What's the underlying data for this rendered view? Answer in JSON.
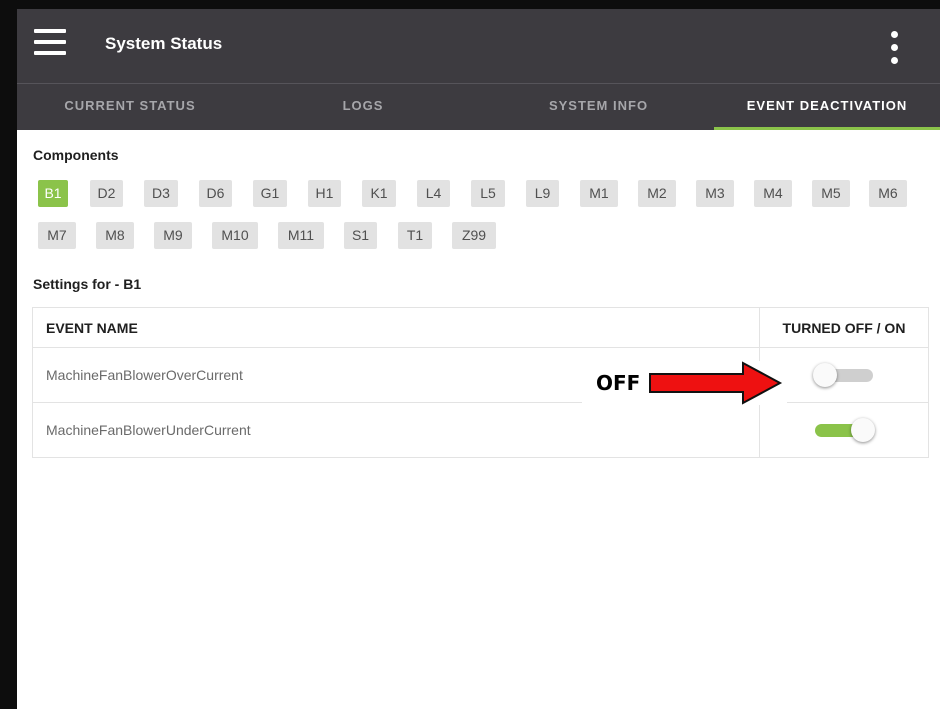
{
  "app": {
    "title": "System Status"
  },
  "tabs": [
    {
      "label": "CURRENT STATUS",
      "active": false
    },
    {
      "label": "LOGS",
      "active": false
    },
    {
      "label": "SYSTEM INFO",
      "active": false
    },
    {
      "label": "EVENT DEACTIVATION",
      "active": true
    }
  ],
  "components": {
    "heading": "Components",
    "selected": "B1",
    "chips": [
      "B1",
      "D2",
      "D3",
      "D6",
      "G1",
      "H1",
      "K1",
      "L4",
      "L5",
      "L9",
      "M1",
      "M2",
      "M3",
      "M4",
      "M5",
      "M6",
      "M7",
      "M8",
      "M9",
      "M10",
      "M11",
      "S1",
      "T1",
      "Z99"
    ]
  },
  "settings": {
    "heading": "Settings for - B1",
    "columns": {
      "event_name": "EVENT NAME",
      "toggle": "TURNED OFF / ON"
    },
    "rows": [
      {
        "event": "MachineFanBlowerOverCurrent",
        "enabled": false
      },
      {
        "event": "MachineFanBlowerUnderCurrent",
        "enabled": true
      }
    ]
  },
  "annotation": {
    "label": "OFF",
    "arrow_color": "#ee1111"
  },
  "colors": {
    "accent": "#8bc34a",
    "appbar": "#3d3b40"
  }
}
